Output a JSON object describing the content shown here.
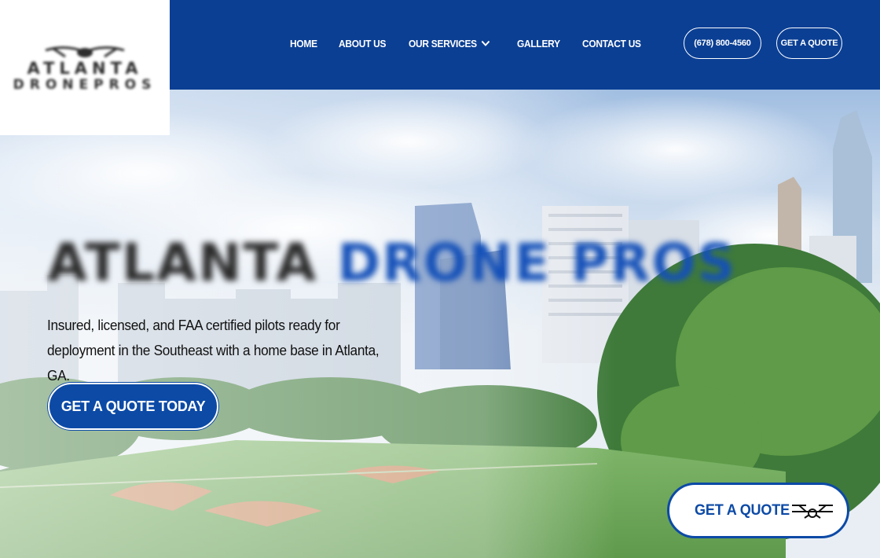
{
  "brand": {
    "logo_line1": "ATLANTA",
    "logo_line2": "DRONEPROS",
    "primary_color": "#0b3f94",
    "accent_color": "#0c4aa6"
  },
  "nav": {
    "items": [
      {
        "label": "HOME"
      },
      {
        "label": "ABOUT US"
      },
      {
        "label": "OUR SERVICES",
        "has_dropdown": true
      },
      {
        "label": "GALLERY"
      },
      {
        "label": "CONTACT US"
      }
    ],
    "phone_label": "(678) 800-4560",
    "quote_label": "GET A QUOTE"
  },
  "hero": {
    "title_part1": "ATLANTA",
    "title_part2": "DRONE",
    "title_part3": "PROS",
    "subtitle": "Insured, licensed, and FAA certified pilots ready for deployment in the Southeast with a home base in Atlanta, GA.",
    "cta_label": "GET A QUOTE TODAY"
  },
  "floating_cta": {
    "label": "GET A QUOTE",
    "icon": "drone-icon"
  }
}
